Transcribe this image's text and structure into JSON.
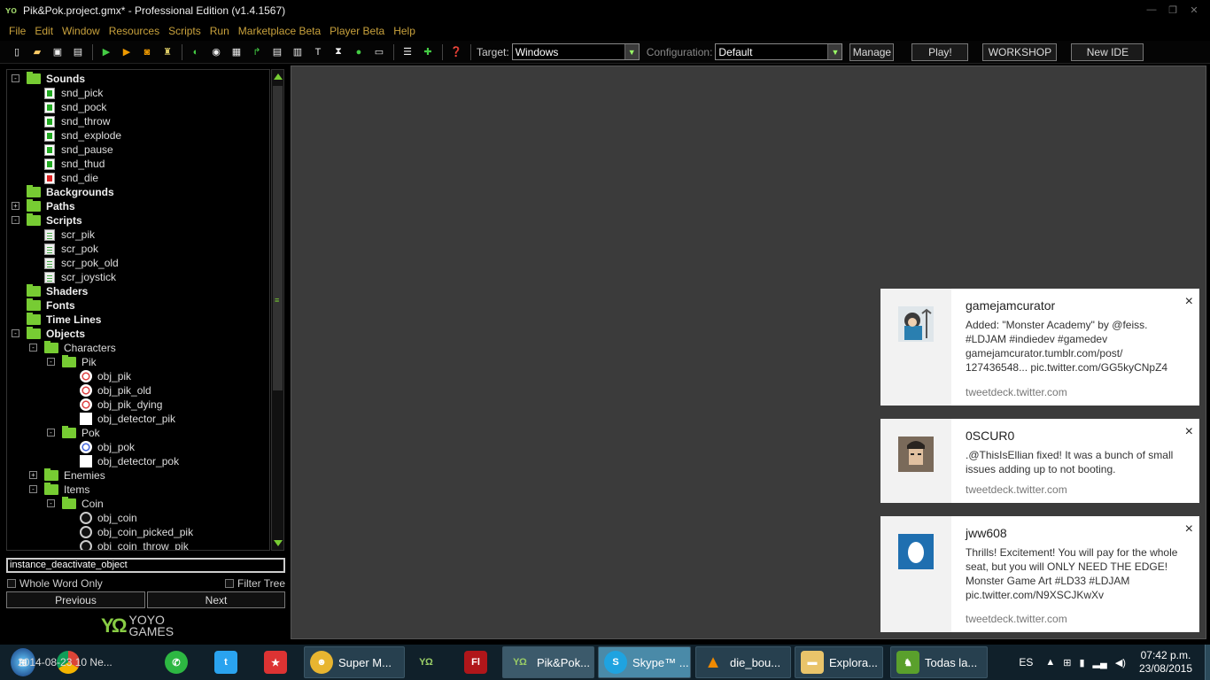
{
  "window": {
    "title": "Pik&Pok.project.gmx*  -  Professional Edition (v1.4.1567)",
    "min": "—",
    "max": "❐",
    "close": "✕"
  },
  "menu": [
    "File",
    "Edit",
    "Window",
    "Resources",
    "Scripts",
    "Run",
    "Marketplace Beta",
    "Player Beta",
    "Help"
  ],
  "toolbar": {
    "target_label": "Target:",
    "target_value": "Windows",
    "config_label": "Configuration:",
    "config_value": "Default",
    "manage": "Manage",
    "play": "Play!",
    "workshop": "WORKSHOP",
    "new_ide": "New IDE"
  },
  "tree": [
    {
      "label": "Sounds",
      "depth": 0,
      "bold": true,
      "icon": "folder",
      "expander": "-"
    },
    {
      "label": "snd_pick",
      "depth": 1,
      "icon": "sound"
    },
    {
      "label": "snd_pock",
      "depth": 1,
      "icon": "sound"
    },
    {
      "label": "snd_throw",
      "depth": 1,
      "icon": "sound"
    },
    {
      "label": "snd_explode",
      "depth": 1,
      "icon": "sound"
    },
    {
      "label": "snd_pause",
      "depth": 1,
      "icon": "sound"
    },
    {
      "label": "snd_thud",
      "depth": 1,
      "icon": "sound"
    },
    {
      "label": "snd_die",
      "depth": 1,
      "icon": "sound-red"
    },
    {
      "label": "Backgrounds",
      "depth": 0,
      "bold": true,
      "icon": "folder"
    },
    {
      "label": "Paths",
      "depth": 0,
      "bold": true,
      "icon": "folder",
      "expander": "+"
    },
    {
      "label": "Scripts",
      "depth": 0,
      "bold": true,
      "icon": "folder",
      "expander": "-"
    },
    {
      "label": "scr_pik",
      "depth": 1,
      "icon": "script"
    },
    {
      "label": "scr_pok",
      "depth": 1,
      "icon": "script"
    },
    {
      "label": "scr_pok_old",
      "depth": 1,
      "icon": "script"
    },
    {
      "label": "scr_joystick",
      "depth": 1,
      "icon": "script"
    },
    {
      "label": "Shaders",
      "depth": 0,
      "bold": true,
      "icon": "folder"
    },
    {
      "label": "Fonts",
      "depth": 0,
      "bold": true,
      "icon": "folder"
    },
    {
      "label": "Time Lines",
      "depth": 0,
      "bold": true,
      "icon": "folder"
    },
    {
      "label": "Objects",
      "depth": 0,
      "bold": true,
      "icon": "folder",
      "expander": "-"
    },
    {
      "label": "Characters",
      "depth": 1,
      "icon": "folder",
      "expander": "-"
    },
    {
      "label": "Pik",
      "depth": 2,
      "icon": "folder",
      "expander": "-"
    },
    {
      "label": "obj_pik",
      "depth": 3,
      "icon": "obj-red"
    },
    {
      "label": "obj_pik_old",
      "depth": 3,
      "icon": "obj-red"
    },
    {
      "label": "obj_pik_dying",
      "depth": 3,
      "icon": "obj-red"
    },
    {
      "label": "obj_detector_pik",
      "depth": 3,
      "icon": "obj-white"
    },
    {
      "label": "Pok",
      "depth": 2,
      "icon": "folder",
      "expander": "-"
    },
    {
      "label": "obj_pok",
      "depth": 3,
      "icon": "obj-blue"
    },
    {
      "label": "obj_detector_pok",
      "depth": 3,
      "icon": "obj-white"
    },
    {
      "label": "Enemies",
      "depth": 1,
      "icon": "folder",
      "expander": "+"
    },
    {
      "label": "Items",
      "depth": 1,
      "icon": "folder",
      "expander": "-"
    },
    {
      "label": "Coin",
      "depth": 2,
      "icon": "folder",
      "expander": "-"
    },
    {
      "label": "obj_coin",
      "depth": 3,
      "icon": "obj-coin"
    },
    {
      "label": "obj_coin_picked_pik",
      "depth": 3,
      "icon": "obj-coin"
    },
    {
      "label": "obj_coin_throw_pik",
      "depth": 3,
      "icon": "obj-coin"
    }
  ],
  "search": {
    "value": "instance_deactivate_object",
    "whole_word": "Whole Word Only",
    "filter": "Filter Tree",
    "previous": "Previous",
    "next": "Next"
  },
  "brand": {
    "mark": "YOYO",
    "line1": "YOYO",
    "line2": "GAMES"
  },
  "notifications": [
    {
      "user": "gamejamcurator",
      "message": "Added: \"Monster Academy\" by @feiss. #LDJAM #indiedev #gamedev gamejamcurator.tumblr.com/post/ 127436548... pic.twitter.com/GG5kyCNpZ4",
      "source": "tweetdeck.twitter.com",
      "close": "×"
    },
    {
      "user": "0SCUR0",
      "message": ".@ThisIsEllian fixed! It was a bunch of small issues adding up to not booting.",
      "source": "tweetdeck.twitter.com",
      "close": "×"
    },
    {
      "user": "jww608",
      "message": "Thrills! Excitement! You will pay for the whole seat, but you will ONLY NEED THE EDGE! Monster Game Art #LD33 #LDJAM pic.twitter.com/N9XSCJKwXv",
      "source": "tweetdeck.twitter.com",
      "close": "×"
    }
  ],
  "taskbar": {
    "apps": [
      {
        "label": "Super M...",
        "icon": "bee-icon",
        "bg": "#e8b530"
      },
      {
        "label": "Pik&Pok...",
        "icon": "gamemaker-icon",
        "bg": "#4a8a2a",
        "active": true
      },
      {
        "label": "Skype™ ...",
        "icon": "skype-icon",
        "bg": "#1fa3e0"
      },
      {
        "label": "die_bou...",
        "icon": "vlc-icon",
        "bg": "#f08a00"
      },
      {
        "label": "Explora...",
        "icon": "explorer-icon",
        "bg": "#e9c46a"
      },
      {
        "label": "Todas la...",
        "icon": "evernote-icon",
        "bg": "#5aa02c"
      }
    ],
    "overlap_text": "2014-08-23 10 Ne...",
    "lang": "ES",
    "time": "07:42 p.m.",
    "date": "23/08/2015"
  }
}
